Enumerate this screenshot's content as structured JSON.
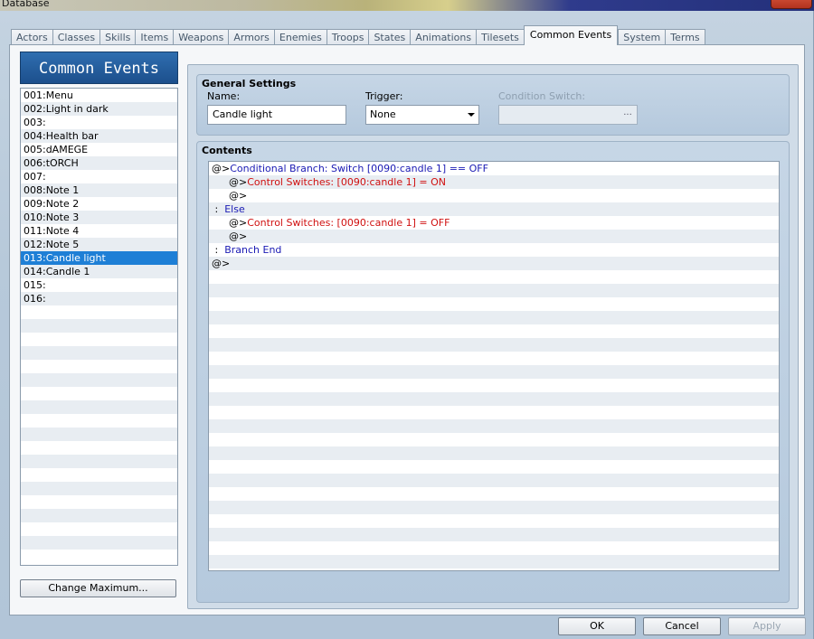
{
  "window": {
    "title": "Database"
  },
  "tabs": [
    {
      "label": "Actors"
    },
    {
      "label": "Classes"
    },
    {
      "label": "Skills"
    },
    {
      "label": "Items"
    },
    {
      "label": "Weapons"
    },
    {
      "label": "Armors"
    },
    {
      "label": "Enemies"
    },
    {
      "label": "Troops"
    },
    {
      "label": "States"
    },
    {
      "label": "Animations"
    },
    {
      "label": "Tilesets"
    },
    {
      "label": "Common Events",
      "active": true
    },
    {
      "label": "System"
    },
    {
      "label": "Terms"
    }
  ],
  "left": {
    "title": "Common Events",
    "items": [
      "001:Menu",
      "002:Light in dark",
      "003:",
      "004:Health bar",
      "005:dAMEGE",
      "006:tORCH",
      "007:",
      "008:Note 1",
      "009:Note 2",
      "010:Note 3",
      "011:Note 4",
      "012:Note 5",
      "013:Candle light",
      "014:Candle 1",
      "015:",
      "016:"
    ],
    "selected_index": 12,
    "change_maximum_label": "Change Maximum..."
  },
  "general": {
    "title": "General Settings",
    "name_label": "Name:",
    "name_value": "Candle light",
    "trigger_label": "Trigger:",
    "trigger_value": "None",
    "condition_label": "Condition Switch:",
    "condition_dots": "..."
  },
  "contents": {
    "title": "Contents",
    "lines": [
      {
        "indent": 0,
        "prefix": "@>",
        "text": "Conditional Branch: Switch [0090:candle 1] == OFF",
        "color": "blue"
      },
      {
        "indent": 1,
        "prefix": "@>",
        "text": "Control Switches: [0090:candle 1] = ON",
        "color": "red"
      },
      {
        "indent": 1,
        "prefix": "@>",
        "text": "",
        "color": "black"
      },
      {
        "indent": 0,
        "prefix": " :  ",
        "text": "Else",
        "color": "blue"
      },
      {
        "indent": 1,
        "prefix": "@>",
        "text": "Control Switches: [0090:candle 1] = OFF",
        "color": "red"
      },
      {
        "indent": 1,
        "prefix": "@>",
        "text": "",
        "color": "black"
      },
      {
        "indent": 0,
        "prefix": " :  ",
        "text": "Branch End",
        "color": "blue"
      },
      {
        "indent": 0,
        "prefix": "@>",
        "text": "",
        "color": "black"
      }
    ]
  },
  "buttons": {
    "ok": "OK",
    "cancel": "Cancel",
    "apply": "Apply"
  },
  "colors": {
    "selected": "#1e7fd6",
    "command_blue": "#1a1ab4",
    "command_red": "#d01010"
  }
}
